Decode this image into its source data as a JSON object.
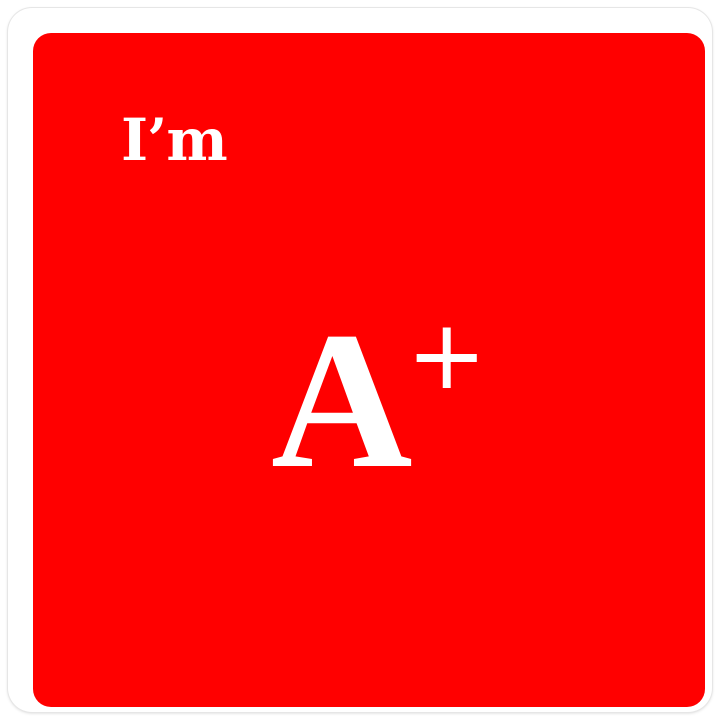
{
  "colors": {
    "card_background": "#ff0000",
    "text": "#ffffff",
    "sticker_border": "#ffffff"
  },
  "badge": {
    "prefix_text": "I’m",
    "grade_letter": "A",
    "grade_modifier": "+"
  }
}
